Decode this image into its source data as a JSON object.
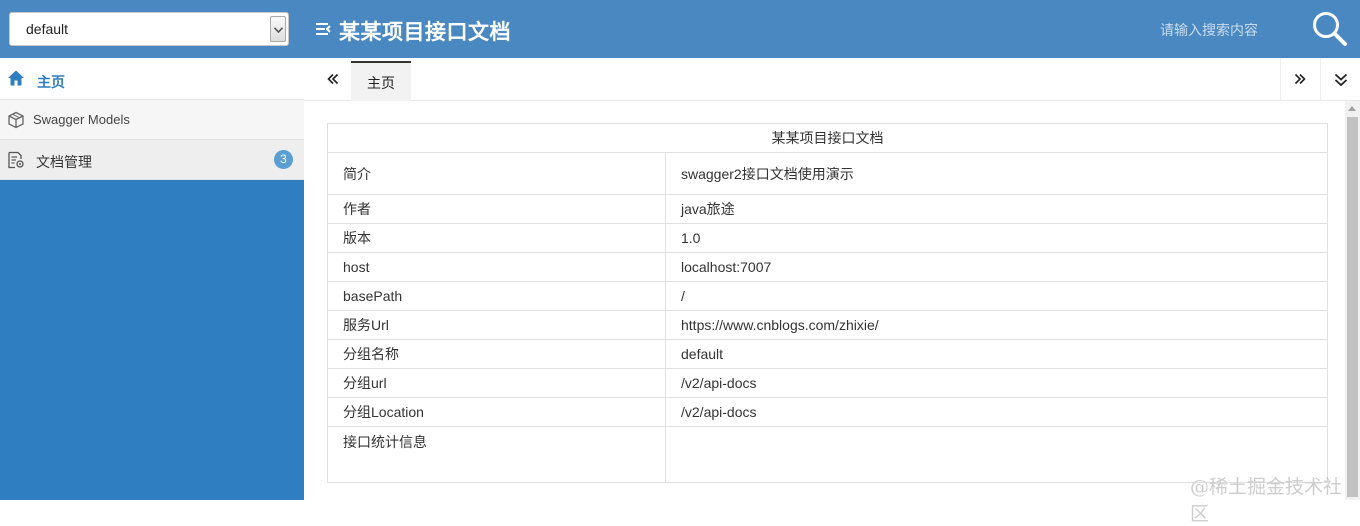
{
  "header": {
    "group_select_value": "default",
    "title": "某某项目接口文档",
    "search_placeholder": "请输入搜索内容"
  },
  "sidebar": {
    "items": [
      {
        "label": "主页",
        "icon": "home-icon"
      },
      {
        "label": "Swagger Models",
        "icon": "cube-icon"
      },
      {
        "label": "文档管理",
        "icon": "doc-settings-icon",
        "badge": "3"
      }
    ]
  },
  "tabs": [
    {
      "label": "主页",
      "active": true
    }
  ],
  "doc": {
    "title": "某某项目接口文档",
    "rows": [
      {
        "key": "简介",
        "value": "swagger2接口文档使用演示"
      },
      {
        "key": "作者",
        "value": "java旅途"
      },
      {
        "key": "版本",
        "value": "1.0"
      },
      {
        "key": "host",
        "value": "localhost:7007"
      },
      {
        "key": "basePath",
        "value": "/"
      },
      {
        "key": "服务Url",
        "value": "https://www.cnblogs.com/zhixie/"
      },
      {
        "key": "分组名称",
        "value": "default"
      },
      {
        "key": "分组url",
        "value": "/v2/api-docs"
      },
      {
        "key": "分组Location",
        "value": "/v2/api-docs"
      },
      {
        "key": "接口统计信息",
        "value": ""
      }
    ]
  },
  "watermark": "@稀土掘金技术社区",
  "colors": {
    "header": "#4a88c2",
    "sidebar": "#2f7ec2",
    "badge": "#5a9fd4"
  }
}
